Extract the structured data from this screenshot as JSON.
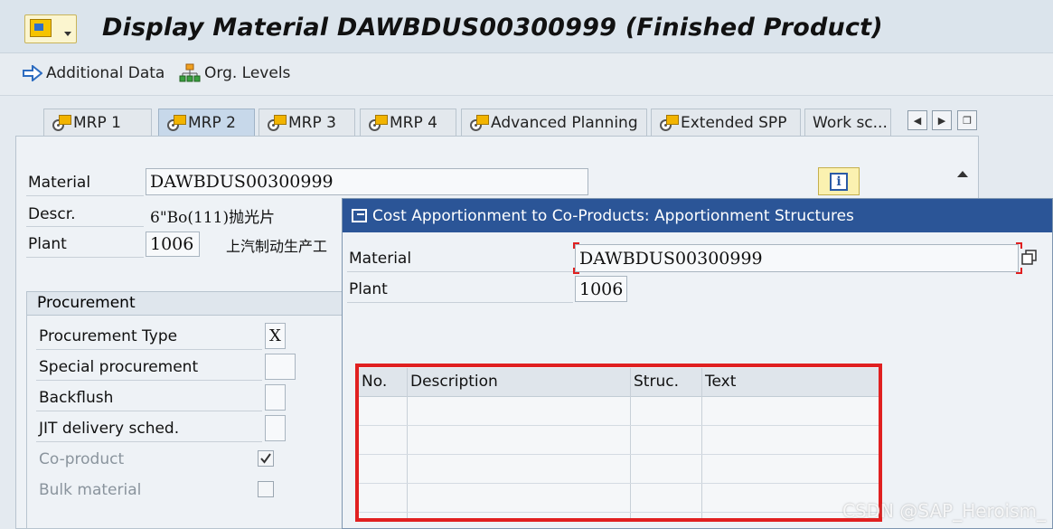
{
  "title": "Display Material DAWBDUS00300999 (Finished Product)",
  "toolbar": {
    "additional_data": "Additional Data",
    "org_levels": "Org. Levels"
  },
  "tabs": [
    {
      "label": "MRP 1"
    },
    {
      "label": "MRP 2"
    },
    {
      "label": "MRP 3"
    },
    {
      "label": "MRP 4"
    },
    {
      "label": "Advanced Planning"
    },
    {
      "label": "Extended SPP"
    },
    {
      "label": "Work sc..."
    }
  ],
  "header": {
    "material_label": "Material",
    "material_value": "DAWBDUS00300999",
    "descr_label": "Descr.",
    "descr_value": "6\"Bo(111)抛光片",
    "plant_label": "Plant",
    "plant_value": "1006",
    "plant_name": "上汽制动生产工"
  },
  "procurement": {
    "title": "Procurement",
    "procurement_type_label": "Procurement Type",
    "procurement_type_value": "X",
    "special_procurement_label": "Special procurement",
    "backflush_label": "Backflush",
    "jit_label": "JIT delivery sched.",
    "coproduct_label": "Co-product",
    "coproduct_checked": true,
    "bulk_material_label": "Bulk material",
    "bulk_material_checked": false
  },
  "dialog": {
    "title": "Cost Apportionment to Co-Products: Apportionment Structures",
    "material_label": "Material",
    "material_value": "DAWBDUS00300999",
    "plant_label": "Plant",
    "plant_value": "1006",
    "table": {
      "columns": [
        "No.",
        "Description",
        "Struc.",
        "Text"
      ]
    }
  },
  "watermark": "CSDN @SAP_Heroism_",
  "colors": {
    "dialog_title_bg": "#2b5597",
    "highlight_red": "#e02020",
    "active_tab": "#c7d8ea"
  }
}
